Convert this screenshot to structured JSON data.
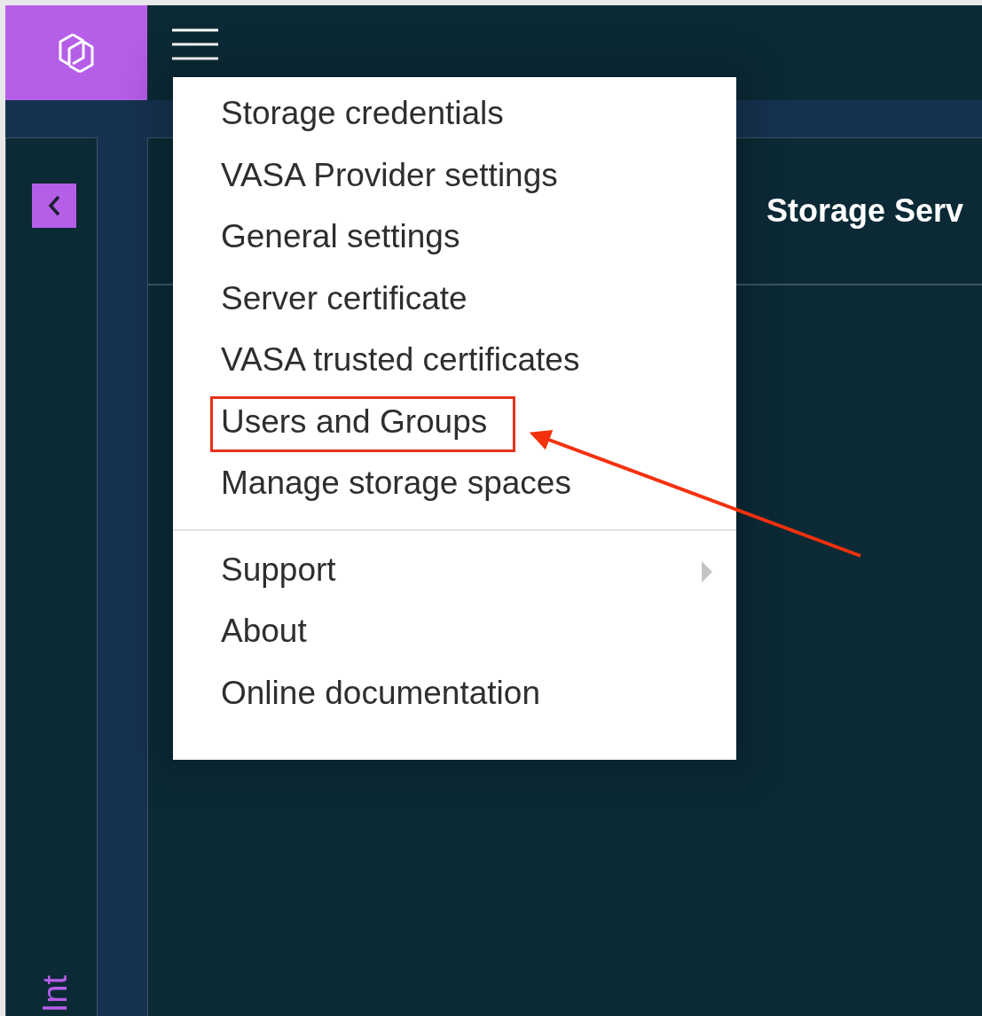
{
  "header": {
    "menu_open": true
  },
  "sidebar": {
    "vertical_label": "Int"
  },
  "main": {
    "title": "Storage Serv"
  },
  "menu": {
    "sections": [
      {
        "items": [
          {
            "label": "Storage credentials",
            "kind": "item",
            "highlighted": false
          },
          {
            "label": "VASA Provider settings",
            "kind": "item",
            "highlighted": false
          },
          {
            "label": "General settings",
            "kind": "item",
            "highlighted": false
          },
          {
            "label": "Server certificate",
            "kind": "item",
            "highlighted": false
          },
          {
            "label": "VASA trusted certificates",
            "kind": "item",
            "highlighted": false
          },
          {
            "label": "Users and Groups",
            "kind": "item",
            "highlighted": true
          },
          {
            "label": "Manage storage spaces",
            "kind": "item",
            "highlighted": false
          }
        ]
      },
      {
        "items": [
          {
            "label": "Support",
            "kind": "submenu",
            "highlighted": false
          },
          {
            "label": "About",
            "kind": "item",
            "highlighted": false
          },
          {
            "label": "Online documentation",
            "kind": "item",
            "highlighted": false
          }
        ]
      }
    ]
  }
}
